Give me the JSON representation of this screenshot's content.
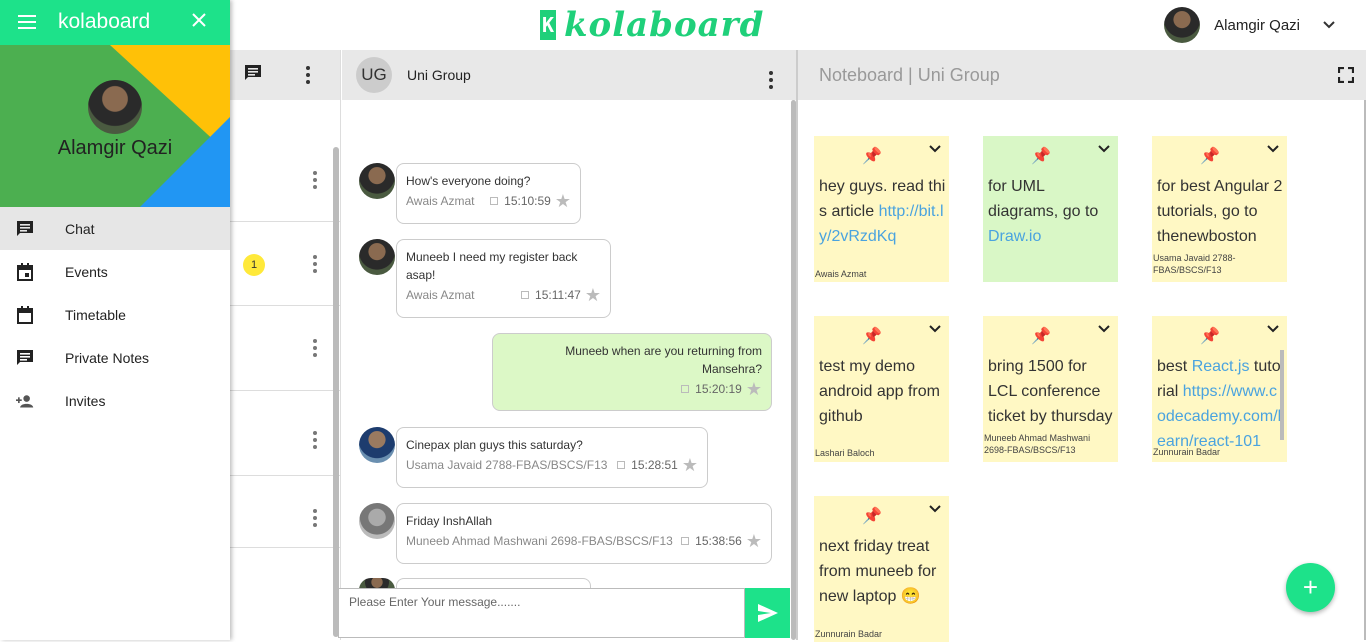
{
  "app": {
    "brand_letter": "K",
    "brand_name": "kolaboard"
  },
  "user": {
    "name": "Alamgir Qazi"
  },
  "drawer": {
    "title": "kolaboard",
    "username": "Alamgir Qazi",
    "items": [
      {
        "label": "Chat",
        "icon": "chat-icon",
        "active": true
      },
      {
        "label": "Events",
        "icon": "calendar-event-icon"
      },
      {
        "label": "Timetable",
        "icon": "calendar-icon"
      },
      {
        "label": "Private Notes",
        "icon": "notes-icon"
      },
      {
        "label": "Invites",
        "icon": "person-add-icon"
      }
    ]
  },
  "contacts": {
    "unread_count": "1"
  },
  "chat": {
    "group_initials": "UG",
    "group_name": "Uni Group",
    "messages": [
      {
        "text": "How's everyone doing?",
        "author": "Awais Azmat",
        "time": "15:10:59",
        "own": false
      },
      {
        "text": "Muneeb I need my register back asap!",
        "author": "Awais Azmat",
        "time": "15:11:47",
        "own": false
      },
      {
        "text": "Muneeb when are you returning from Mansehra?",
        "author": "",
        "time": "15:20:19",
        "own": true
      },
      {
        "text": "Cinepax plan guys this saturday?",
        "author": "Usama Javaid 2788-FBAS/BSCS/F13",
        "time": "15:28:51",
        "own": false
      },
      {
        "text": "Friday InshAllah",
        "author": "Muneeb Ahmad Mashwani 2698-FBAS/BSCS/F13",
        "time": "15:38:56",
        "own": false
      }
    ],
    "placeholder": "Please Enter Your message......."
  },
  "board": {
    "title": "Noteboard | Uni Group",
    "notes": [
      {
        "pre": "hey guys. read this article ",
        "link": "http://bit.ly/2vRzdKq",
        "post": "",
        "author": "Awais Azmat",
        "color": "#fff8c4"
      },
      {
        "pre": "for UML diagrams, go to ",
        "link": "Draw.io",
        "post": "",
        "author": "",
        "color": "#d9f7c6"
      },
      {
        "pre": "for best Angular 2 tutorials, go to thenewboston",
        "link": "",
        "post": "",
        "author": "Usama Javaid 2788-FBAS/BSCS/F13",
        "color": "#fff8c4"
      },
      {
        "pre": "test my demo android app from github",
        "link": "",
        "post": "",
        "author": "Lashari Baloch",
        "color": "#fff8c4"
      },
      {
        "pre": "bring 1500 for LCL conference ticket by thursday",
        "link": "",
        "post": "",
        "author": "Muneeb Ahmad Mashwani 2698-FBAS/BSCS/F13",
        "color": "#fff8c4"
      },
      {
        "pre": "best ",
        "link": "React.js",
        "post": " tutorial ",
        "link2": "https://www.codecademy.com/learn/react-101",
        "author": "Zunnurain Badar",
        "color": "#fff8c4"
      },
      {
        "pre": "next friday treat from muneeb for new laptop 😁",
        "link": "",
        "post": "",
        "author": "Zunnurain Badar",
        "color": "#fff8c4"
      }
    ]
  },
  "colors": {
    "accent": "#1de28a",
    "own_bubble": "#dcf8c6",
    "note_yellow": "#fff8c4",
    "note_green": "#d9f7c6",
    "link": "#4aa3df"
  }
}
